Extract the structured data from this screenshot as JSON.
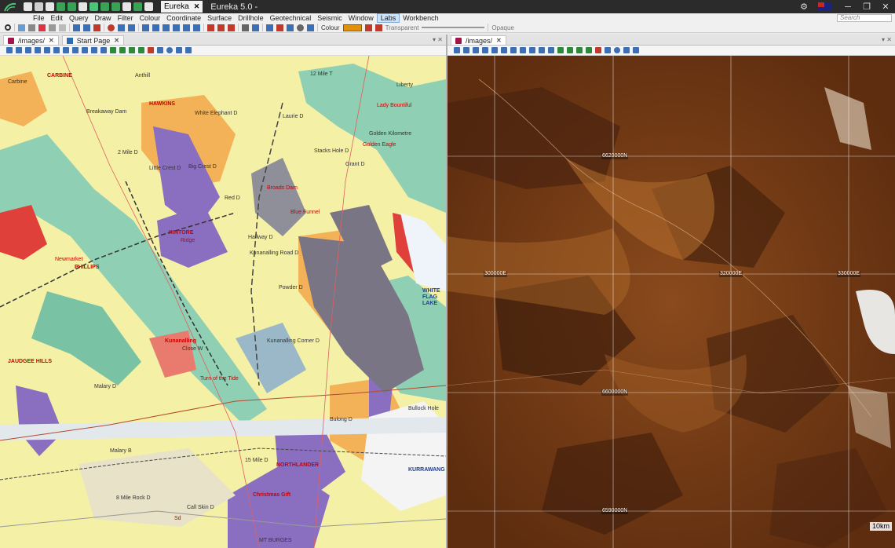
{
  "app": {
    "name": "Eureka",
    "window_title": "Eureka 5.0 -",
    "tab_close": "✕"
  },
  "colors": {
    "titlebar": "#2b2b2b",
    "accent_swatch": "#e0920c",
    "doc_icon": "#a0164a"
  },
  "menu": {
    "items": [
      "File",
      "Edit",
      "Query",
      "Draw",
      "Filter",
      "Colour",
      "Coordinate",
      "Surface",
      "Drillhole",
      "Geotechnical",
      "Seismic",
      "Window",
      "Labs",
      "Workbench"
    ],
    "active": "Labs",
    "search_placeholder": "Search"
  },
  "toolbar": {
    "colour_label": "Colour",
    "transparent_label": "Transparent",
    "opaque_label": "Opaque"
  },
  "left_pane": {
    "tabs": [
      {
        "label": "/images/",
        "close": "✕"
      },
      {
        "label": "Start Page",
        "close": "✕"
      }
    ],
    "map_labels": [
      "CARBINE",
      "HAWKINS",
      "Anthill",
      "Breakaway Dam",
      "White Elephant D",
      "Lady Bountiful",
      "Golden Kilometre",
      "Liberty",
      "12 Mile T",
      "2 Mile D",
      "Big Crest D",
      "Little Crest D",
      "Laurie D",
      "Stacks Hole D",
      "Grant D",
      "Broads Dam",
      "Blue Funnel",
      "Red D",
      "KINTORE",
      "Ridge",
      "Newmarket",
      "PHILLIPS",
      "Hallway D",
      "Kunanalling Road D",
      "Powder D",
      "Kunanalling Corner D",
      "Kunanalling",
      "Close W",
      "Turn of the Tide",
      "JAUDGEE HILLS",
      "Malary D",
      "Malary B",
      "8 Mile Rock D",
      "Call Skin D",
      "Christmas Gift",
      "NORTHLANDER",
      "15 Mile D",
      "Bullock Hole",
      "KURRAWANG LAKE",
      "MT BURGES",
      "WHITE FLAG LAKE",
      "Sd",
      "Carbine",
      "Golden Eagle",
      "Bulong D"
    ],
    "road_label": "Kunanalling"
  },
  "right_pane": {
    "tabs": [
      {
        "label": "/images/",
        "close": "✕"
      }
    ],
    "grid_labels": {
      "northings": [
        "6620000N",
        "6600000N",
        "6590000N"
      ],
      "eastings": [
        "300000E",
        "320000E",
        "330000E"
      ]
    },
    "scale_label": "10km"
  }
}
